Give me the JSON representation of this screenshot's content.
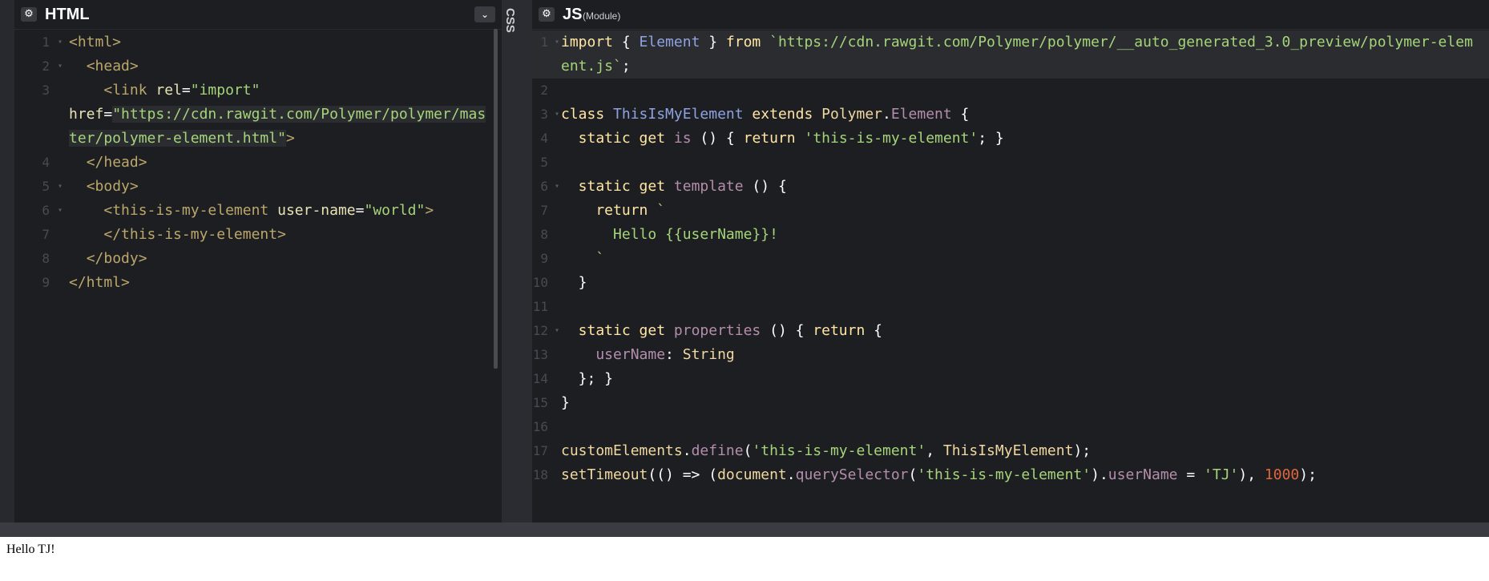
{
  "html_panel": {
    "title": "HTML",
    "settings_icon": "gear-icon",
    "dropdown_icon": "chevron-down-icon",
    "line_numbers": [
      "1",
      "2",
      "3",
      "",
      "",
      "4",
      "5",
      "6",
      "7",
      "8",
      "9"
    ]
  },
  "css_panel": {
    "title": "CSS"
  },
  "js_panel": {
    "title": "JS",
    "subtitle": "(Module)",
    "settings_icon": "gear-icon",
    "line_numbers": [
      "1",
      "",
      "2",
      "3",
      "4",
      "5",
      "6",
      "7",
      "8",
      "9",
      "10",
      "11",
      "12",
      "13",
      "14",
      "15",
      "16",
      "17",
      "18"
    ]
  },
  "html_code": {
    "l1_tag": "<html>",
    "l2_tag": "<head>",
    "l3_open": "<link ",
    "l3_attr": "rel",
    "l3_eq": "=",
    "l3_val": "\"import\"",
    "l3b_attr": "href",
    "l3b_eq": "=",
    "l3b_val": "\"https://cdn.rawgit.com/Polymer/polymer/master/polymer-element.html\"",
    "l3b_close": ">",
    "l4_tag": "</head>",
    "l5_tag": "<body>",
    "l6_open": "<this-is-my-element ",
    "l6_attr": "user-name",
    "l6_eq": "=",
    "l6_val": "\"world\"",
    "l6_close": ">",
    "l7_tag": "</this-is-my-element>",
    "l8_tag": "</body>",
    "l9_tag": "</html>"
  },
  "js_code": {
    "l1_import": "import",
    "l1_brace_open": " { ",
    "l1_element": "Element",
    "l1_brace_close": " } ",
    "l1_from": "from",
    "l1_url": " `https://cdn.rawgit.com/Polymer/polymer/__auto_generated_3.0_preview/polymer-element.js`",
    "l1_semi": ";",
    "l3_class": "class ",
    "l3_name": "ThisIsMyElement",
    "l3_extends": " extends ",
    "l3_polymer": "Polymer",
    "l3_dot": ".",
    "l3_element": "Element",
    "l3_brace": " {",
    "l4_static": "  static get ",
    "l4_is": "is",
    "l4_paren": " () { ",
    "l4_return": "return",
    "l4_str": " 'this-is-my-element'",
    "l4_end": "; }",
    "l6_static": "  static get ",
    "l6_template": "template",
    "l6_paren": " () {",
    "l7_return": "    return ",
    "l7_tick": "`",
    "l8_hello": "      Hello {{userName}}!",
    "l9_tick": "    `",
    "l10_brace": "  }",
    "l12_static": "  static get ",
    "l12_props": "properties",
    "l12_paren": " () { ",
    "l12_return": "return",
    "l12_brace": " {",
    "l13_key": "    userName",
    "l13_colon": ": ",
    "l13_type": "String",
    "l14_end": "  }; }",
    "l15_end": "}",
    "l17_ce": "customElements",
    "l17_dot": ".",
    "l17_define": "define",
    "l17_open": "(",
    "l17_str": "'this-is-my-element'",
    "l17_comma": ", ",
    "l17_cls": "ThisIsMyElement",
    "l17_close": ");",
    "l18_fn": "setTimeout",
    "l18_a": "(() => (",
    "l18_doc": "document",
    "l18_dot": ".",
    "l18_qs": "querySelector",
    "l18_open": "(",
    "l18_str": "'this-is-my-element'",
    "l18_close": ").",
    "l18_user": "userName",
    "l18_eq": " = ",
    "l18_tj": "'TJ'",
    "l18_b": "), ",
    "l18_num": "1000",
    "l18_end": ");"
  },
  "result": {
    "text": "Hello TJ!"
  }
}
